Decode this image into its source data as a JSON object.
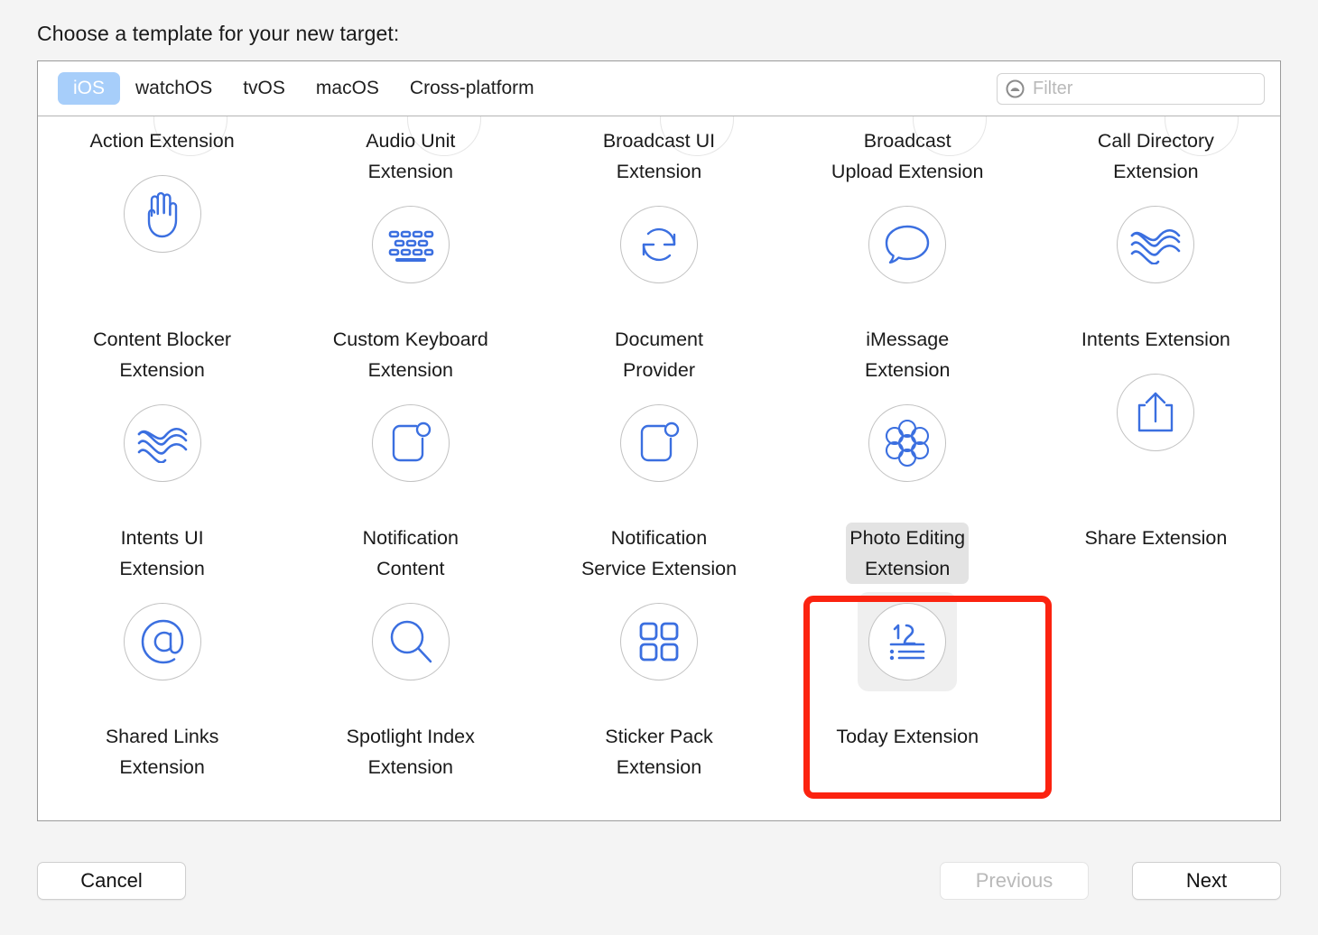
{
  "prompt": "Choose a template for your new target:",
  "tabs": [
    {
      "label": "iOS",
      "selected": true
    },
    {
      "label": "watchOS",
      "selected": false
    },
    {
      "label": "tvOS",
      "selected": false
    },
    {
      "label": "macOS",
      "selected": false
    },
    {
      "label": "Cross-platform",
      "selected": false
    }
  ],
  "filter": {
    "placeholder": "Filter",
    "value": "",
    "icon": "filter-circle-icon"
  },
  "colors": {
    "accent_blue": "#3b6fe0",
    "tab_selected_bg": "#a7cefa",
    "annotation_red": "#fb2310",
    "selection_bg": "#e3e3e3",
    "icon_ring": "#c2c2c2",
    "page_bg": "#f4f4f4"
  },
  "templates": [
    {
      "label": "Action Extension",
      "icon": "hand-icon",
      "selected": false
    },
    {
      "label": "Audio Unit\nExtension",
      "icon": "keyboard-icon",
      "selected": false
    },
    {
      "label": "Broadcast UI\nExtension",
      "icon": "refresh-circular-arrows-icon",
      "selected": false
    },
    {
      "label": "Broadcast\nUpload Extension",
      "icon": "speech-bubble-icon",
      "selected": false
    },
    {
      "label": "Call Directory\nExtension",
      "icon": "crossing-waves-icon",
      "selected": false
    },
    {
      "label": "Content Blocker\nExtension",
      "icon": "crossing-waves-icon",
      "selected": false
    },
    {
      "label": "Custom Keyboard\nExtension",
      "icon": "rounded-square-badge-icon",
      "selected": false
    },
    {
      "label": "Document\nProvider",
      "icon": "rounded-square-badge-icon",
      "selected": false
    },
    {
      "label": "iMessage\nExtension",
      "icon": "rosette-flower-icon",
      "selected": false
    },
    {
      "label": "Intents Extension",
      "icon": "share-upload-icon",
      "selected": false
    },
    {
      "label": "Intents UI\nExtension",
      "icon": "at-sign-icon",
      "selected": false
    },
    {
      "label": "Notification\nContent",
      "icon": "magnifier-icon",
      "selected": false
    },
    {
      "label": "Notification\nService Extension",
      "icon": "grid-four-squares-icon",
      "selected": false
    },
    {
      "label": "Photo Editing\nExtension",
      "icon": "today-calendar-list-icon",
      "selected": true
    },
    {
      "label": "Share Extension",
      "icon": "none",
      "selected": false
    },
    {
      "label": "Shared Links\nExtension",
      "icon": "none",
      "selected": false
    },
    {
      "label": "Spotlight Index\nExtension",
      "icon": "none",
      "selected": false
    },
    {
      "label": "Sticker Pack\nExtension",
      "icon": "none",
      "selected": false
    },
    {
      "label": "Today Extension",
      "icon": "none",
      "selected": false
    },
    {
      "label": "",
      "icon": "none",
      "selected": false
    }
  ],
  "footer": {
    "cancel": "Cancel",
    "previous": "Previous",
    "next": "Next",
    "previous_disabled": true
  }
}
